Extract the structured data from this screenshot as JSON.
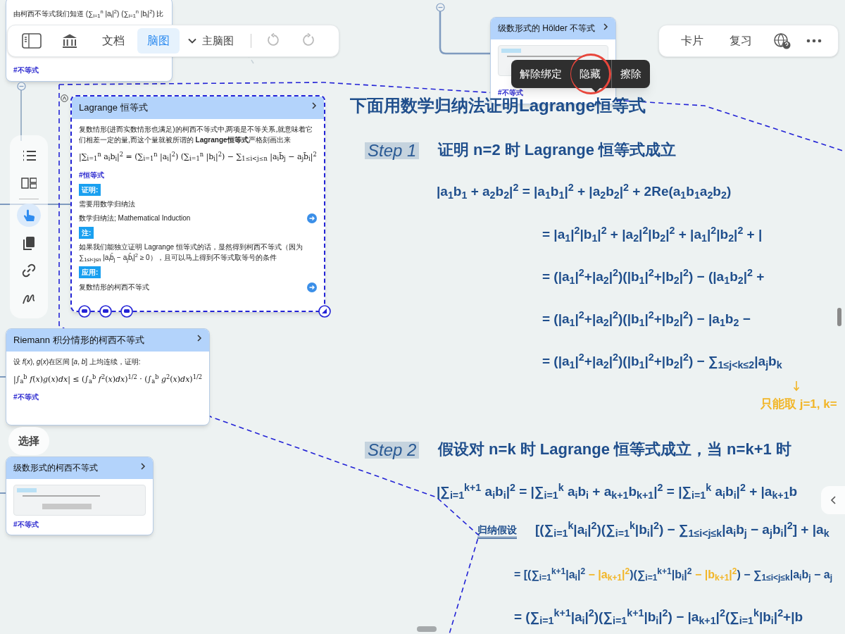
{
  "main_toolbar": {
    "tabs": [
      {
        "label": "文档",
        "selected": false
      },
      {
        "label": "脑图",
        "selected": true
      }
    ],
    "map_selector": {
      "label": "主脑图"
    },
    "undo": {
      "disabled": true
    },
    "redo": {
      "disabled": true
    }
  },
  "right_toolbar": {
    "buttons": [
      "卡片",
      "复习"
    ]
  },
  "context_menu": {
    "items": [
      {
        "label": "解除绑定",
        "circled": false
      },
      {
        "label": "隐藏",
        "circled": true
      },
      {
        "label": "擦除",
        "circled": false
      }
    ]
  },
  "tool_rail": {
    "tools": [
      {
        "kind": "list",
        "selected": false
      },
      {
        "kind": "layout",
        "selected": false
      },
      {
        "kind": "hand",
        "selected": true
      },
      {
        "kind": "copy",
        "selected": false
      },
      {
        "kind": "link",
        "selected": false
      },
      {
        "kind": "pen",
        "selected": false
      }
    ],
    "tooltip": "选择"
  },
  "cards": [
    {
      "kind": "partial",
      "selected": false,
      "blocks": [
        {
          "kind": "p",
          "text": "由柯西不等式我们知道 (∑$_{i=1}$$^{n}$ |a$_{i}$|$^{2}$) (∑$_{i=1}$$^{n}$ |b$_{i}$|$^{2}$) 比"
        },
        {
          "kind": "tag",
          "text": "#不等式"
        }
      ]
    },
    {
      "kind": "thumbnail",
      "selected": false,
      "title": "级数形式的 Hölder 不等式",
      "blocks": [
        {
          "kind": "image"
        },
        {
          "kind": "tag",
          "text": "#不等式"
        }
      ]
    },
    {
      "kind": "full",
      "selected": true,
      "title": "Lagrange 恒等式",
      "blocks": [
        {
          "kind": "p",
          "text": "复数情形(进而实数情形也满足)的柯西不等式中,两项是不等关系,就意味着它们相差一定的量,而这个量就被所谓的 **Lagrange恒等式**严格刻画出来"
        },
        {
          "kind": "formula",
          "text": "|∑$_{i=1}$$^{n}$ a$_{i}$b$_{i}$|$^{2}$ = (∑$_{i=1}$$^{n}$ |a$_{i}$|$^{2}$) (∑$_{i=1}$$^{n}$ |b$_{i}$|$^{2}$) − ∑$_{1≤i<j≤n}$ |a$_{i}$b̄$_{j}$ − a$_{j}$b̄$_{i}$|$^{2}$"
        },
        {
          "kind": "tag",
          "text": "#恒等式"
        },
        {
          "kind": "heading",
          "text": "证明:"
        },
        {
          "kind": "p",
          "text": "需要用数学归纳法"
        },
        {
          "kind": "link",
          "text": "数学归纳法; Mathematical Induction"
        },
        {
          "kind": "heading",
          "text": "注:"
        },
        {
          "kind": "p",
          "text": "如果我们能独立证明 Lagrange 恒等式的话，显然得到柯西不等式（因为 ∑$_{1≤i<j≤n}$ |a$_{i}$b̄$_{j}$ − a$_{j}$b̄$_{i}$|$^{2}$ ≥ 0），且可以马上得到不等式取等号的条件"
        },
        {
          "kind": "heading",
          "text": "应用:"
        },
        {
          "kind": "link",
          "text": "复数情形的柯西不等式"
        }
      ]
    },
    {
      "kind": "full",
      "selected": false,
      "title": "Riemann 积分情形的柯西不等式",
      "blocks": [
        {
          "kind": "p",
          "text": "设 *f*(*x*), *g*(*x*)在区间 [*a*, *b*] 上均连续，证明:"
        },
        {
          "kind": "formula",
          "text": "|∫$_{a}$$^{b}$ *f*(*x*)*g*(*x*)*dx*| ≤ (∫$_{a}$$^{b}$ *f*$^{2}$(*x*)*dx*)$^{1/2}$ · (∫$_{a}$$^{b}$ *g*$^{2}$(*x*)*dx*)$^{1/2}$"
        },
        {
          "kind": "tag",
          "text": "#不等式"
        }
      ]
    },
    {
      "kind": "thumbnail",
      "selected": false,
      "title": "级数形式的柯西不等式",
      "blocks": [
        {
          "kind": "image"
        },
        {
          "kind": "tag",
          "text": "#不等式"
        }
      ]
    }
  ],
  "handwritten_notes": [
    {
      "kind": "title",
      "segments": [
        {
          "text": "下面用数学归纳法证明Lagrange恒等式",
          "highlight": false
        }
      ]
    },
    {
      "kind": "step",
      "label": "Step 1",
      "segments": [
        {
          "text": "证明 n=2 时 Lagrange 恒等式成立",
          "highlight": false
        }
      ]
    },
    {
      "kind": "formula",
      "segments": [
        {
          "text": "|a$_{1}$b$_{1}$ + a$_{2}$b$_{2}$|$^{2}$ = |a$_{1}$b$_{1}$|$^{2}$ + |a$_{2}$b$_{2}$|$^{2}$ + 2Re(a$_{1}$b$_{1}$a$_{2}$b$_{2}$)",
          "highlight": false
        }
      ]
    },
    {
      "kind": "formula",
      "segments": [
        {
          "text": "= |a$_{1}$|$^{2}$|b$_{1}$|$^{2}$ + |a$_{2}$|$^{2}$|b$_{2}$|$^{2}$ + |a$_{1}$|$^{2}$|b$_{2}$|$^{2}$ + |",
          "highlight": false
        }
      ]
    },
    {
      "kind": "formula",
      "segments": [
        {
          "text": "= (|a$_{1}$|$^{2}$+|a$_{2}$|$^{2}$)(|b$_{1}$|$^{2}$+|b$_{2}$|$^{2}$) − (|a$_{1}$b$_{2}$|$^{2}$ +",
          "highlight": false
        }
      ]
    },
    {
      "kind": "formula",
      "segments": [
        {
          "text": "= (|a$_{1}$|$^{2}$+|a$_{2}$|$^{2}$)(|b$_{1}$|$^{2}$+|b$_{2}$|$^{2}$) − |a$_{1}$b$_{2}$ −",
          "highlight": false
        }
      ]
    },
    {
      "kind": "formula",
      "segments": [
        {
          "text": "= (|a$_{1}$|$^{2}$+|a$_{2}$|$^{2}$)(|b$_{1}$|$^{2}$+|b$_{2}$|$^{2}$) − ∑$_{1≤j<k≤2}$|a$_{j}$b$_{k}$",
          "highlight": false
        }
      ]
    },
    {
      "kind": "note",
      "segments": [
        {
          "text": "只能取 j=1, k=",
          "highlight": true
        }
      ]
    },
    {
      "kind": "step",
      "label": "Step 2",
      "segments": [
        {
          "text": "假设对 n=k 时 Lagrange 恒等式成立，当 n=k+1 时",
          "highlight": false
        }
      ]
    },
    {
      "kind": "formula",
      "segments": [
        {
          "text": "|∑$_{i=1}$$^{k+1}$ a$_{i}$b$_{i}$|$^{2}$ = |∑$_{i=1}$$^{k}$ a$_{i}$b$_{i}$ + a$_{k+1}$b$_{k+1}$|$^{2}$ = |∑$_{i=1}$$^{k}$ a$_{i}$b$_{i}$|$^{2}$ + |a$_{k+1}$b",
          "highlight": false
        }
      ]
    },
    {
      "kind": "labeled",
      "label": "归纳假设",
      "segments": [
        {
          "text": "[(∑$_{i=1}$$^{k}$|a$_{i}$|$^{2}$)(∑$_{i=1}$$^{k}$|b$_{i}$|$^{2}$) − ∑$_{1≤i<j≤k}$|a$_{i}$b$_{j}$ − a$_{j}$b$_{i}$|$^{2}$] + |a$_{k}$",
          "highlight": false
        }
      ]
    },
    {
      "kind": "formula",
      "segments": [
        {
          "text": "= [(∑$_{i=1}$$^{k+1}$|a$_{i}$|$^{2}$",
          "highlight": false
        },
        {
          "text": " − |a$_{k+1}$|$^{2}$",
          "highlight": true
        },
        {
          "text": ")(∑$_{i=1}$$^{k+1}$|b$_{i}$|$^{2}$",
          "highlight": false
        },
        {
          "text": " − |b$_{k+1}$|$^{2}$",
          "highlight": true
        },
        {
          "text": ") − ∑$_{1≤i<j≤k}$|a$_{i}$b$_{j}$ − a$_{j}$",
          "highlight": false
        }
      ]
    },
    {
      "kind": "formula",
      "segments": [
        {
          "text": "= (∑$_{i=1}$$^{k+1}$|a$_{i}$|$^{2}$)(∑$_{i=1}$$^{k+1}$|b$_{i}$|$^{2}$) − |a$_{k+1}$|$^{2}$(∑$_{i=1}$$^{k}$|b$_{i}$|$^{2}$+|b",
          "highlight": false
        }
      ]
    }
  ]
}
